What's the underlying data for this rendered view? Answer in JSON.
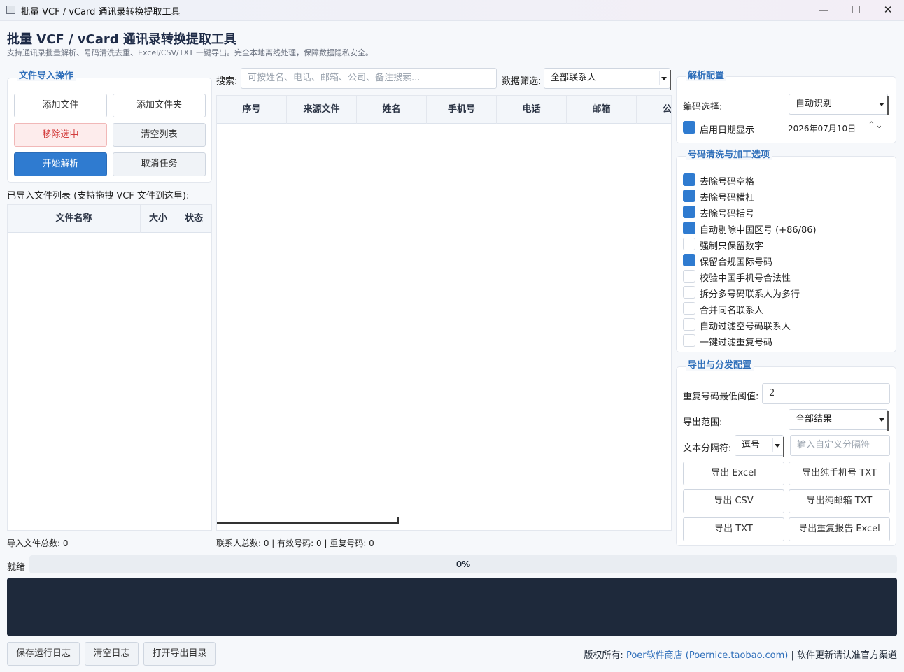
{
  "window": {
    "title": "批量 VCF / vCard 通讯录转换提取工具"
  },
  "header": {
    "title": "批量 VCF / vCard 通讯录转换提取工具",
    "subtitle": "支持通讯录批量解析、号码清洗去重、Excel/CSV/TXT 一键导出。完全本地离线处理，保障数据隐私安全。"
  },
  "import_group": {
    "title": "文件导入操作",
    "add_file": "添加文件",
    "add_folder": "添加文件夹",
    "remove_selected": "移除选中",
    "clear_list": "清空列表",
    "start_parse": "开始解析",
    "cancel_task": "取消任务"
  },
  "file_list": {
    "label": "已导入文件列表 (支持拖拽 VCF 文件到这里):",
    "columns": [
      "文件名称",
      "大小",
      "状态"
    ],
    "total": "导入文件总数: 0"
  },
  "search": {
    "label": "搜索:",
    "placeholder": "可按姓名、电话、邮箱、公司、备注搜索...",
    "filter_label": "数据筛选:",
    "filter_value": "全部联系人"
  },
  "contacts_table": {
    "columns": [
      "序号",
      "来源文件",
      "姓名",
      "手机号",
      "电话",
      "邮箱",
      "公"
    ],
    "summary": "联系人总数: 0 | 有效号码: 0 | 重复号码: 0"
  },
  "parse_config": {
    "title": "解析配置",
    "encoding_label": "编码选择:",
    "encoding_value": "自动识别",
    "date_label": "启用日期显示",
    "date_value": "2026年07月10日"
  },
  "clean_options": {
    "title": "号码清洗与加工选项",
    "items": [
      {
        "label": "去除号码空格",
        "checked": true
      },
      {
        "label": "去除号码横杠",
        "checked": true
      },
      {
        "label": "去除号码括号",
        "checked": true
      },
      {
        "label": "自动剔除中国区号 (+86/86)",
        "checked": true
      },
      {
        "label": "强制只保留数字",
        "checked": false
      },
      {
        "label": "保留合规国际号码",
        "checked": true
      },
      {
        "label": "校验中国手机号合法性",
        "checked": false
      },
      {
        "label": "拆分多号码联系人为多行",
        "checked": false
      },
      {
        "label": "合并同名联系人",
        "checked": false
      },
      {
        "label": "自动过滤空号码联系人",
        "checked": false
      },
      {
        "label": "一键过滤重复号码",
        "checked": false
      }
    ]
  },
  "export_config": {
    "title": "导出与分发配置",
    "threshold_label": "重复号码最低阈值:",
    "threshold_value": "2",
    "range_label": "导出范围:",
    "range_value": "全部结果",
    "sep_label": "文本分隔符:",
    "sep_value": "逗号",
    "sep_placeholder": "输入自定义分隔符",
    "export_excel": "导出 Excel",
    "export_phone_txt": "导出纯手机号 TXT",
    "export_csv": "导出 CSV",
    "export_email_txt": "导出纯邮箱 TXT",
    "export_txt": "导出 TXT",
    "export_dup_report": "导出重复报告 Excel"
  },
  "progress": {
    "status": "就绪",
    "percent_text": "0%",
    "value": 0
  },
  "footer": {
    "save_log": "保存运行日志",
    "clear_log": "清空日志",
    "open_dir": "打开导出目录",
    "copyright_prefix": "版权所有:",
    "copyright_link": "Poer软件商店 (Poernice.taobao.com)",
    "copyright_suffix": "| 软件更新请认准官方渠道"
  },
  "colors": {
    "accent": "#2f7bd0",
    "danger": "#d33b3b",
    "log_bg": "#1e293b",
    "group_title": "#2f6fba"
  }
}
